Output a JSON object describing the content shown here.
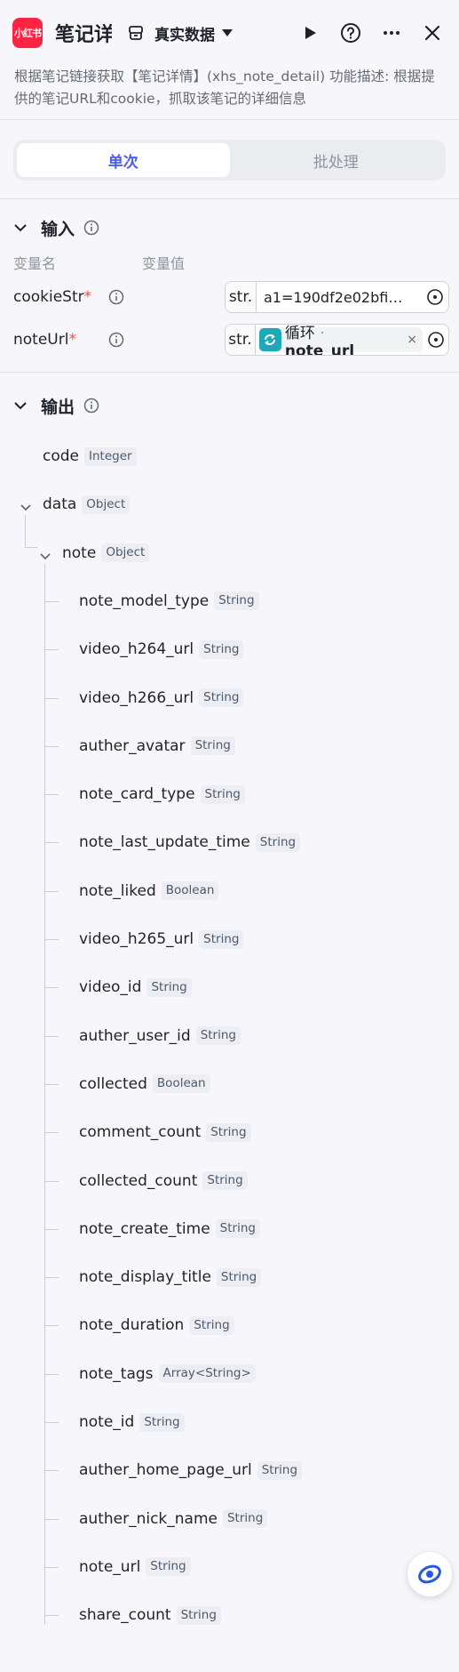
{
  "header": {
    "logo_text": "小红书",
    "title": "笔记详情",
    "dataset_label": "真实数据",
    "icons": [
      "dataset-icon",
      "caret-down-icon",
      "play-icon",
      "help-icon",
      "more-icon",
      "close-icon"
    ]
  },
  "description": "根据笔记链接获取【笔记详情】(xhs_note_detail) 功能描述: 根据提供的笔记URL和cookie，抓取该笔记的详细信息",
  "tabs": [
    {
      "label": "单次",
      "active": true
    },
    {
      "label": "批处理",
      "active": false
    }
  ],
  "input_section": {
    "title": "输入",
    "col_name": "变量名",
    "col_value": "变量值",
    "vars": [
      {
        "name": "cookieStr",
        "required": "*",
        "type": "str.",
        "value": "a1=190df2e02bfi…"
      },
      {
        "name": "noteUrl",
        "required": "*",
        "type": "str.",
        "ref_source": "循环",
        "ref_sep": " · ",
        "ref_var": "note_url",
        "remove": "×"
      }
    ]
  },
  "output_section": {
    "title": "输出",
    "fields": [
      {
        "name": "code",
        "type": "Integer"
      },
      {
        "name": "data",
        "type": "Object"
      },
      {
        "name": "note",
        "type": "Object"
      },
      {
        "name": "note_model_type",
        "type": "String"
      },
      {
        "name": "video_h264_url",
        "type": "String"
      },
      {
        "name": "video_h266_url",
        "type": "String"
      },
      {
        "name": "auther_avatar",
        "type": "String"
      },
      {
        "name": "note_card_type",
        "type": "String"
      },
      {
        "name": "note_last_update_time",
        "type": "String"
      },
      {
        "name": "note_liked",
        "type": "Boolean"
      },
      {
        "name": "video_h265_url",
        "type": "String"
      },
      {
        "name": "video_id",
        "type": "String"
      },
      {
        "name": "auther_user_id",
        "type": "String"
      },
      {
        "name": "collected",
        "type": "Boolean"
      },
      {
        "name": "comment_count",
        "type": "String"
      },
      {
        "name": "collected_count",
        "type": "String"
      },
      {
        "name": "note_create_time",
        "type": "String"
      },
      {
        "name": "note_display_title",
        "type": "String"
      },
      {
        "name": "note_duration",
        "type": "String"
      },
      {
        "name": "note_tags",
        "type": "Array<String>"
      },
      {
        "name": "note_id",
        "type": "String"
      },
      {
        "name": "auther_home_page_url",
        "type": "String"
      },
      {
        "name": "auther_nick_name",
        "type": "String"
      },
      {
        "name": "note_url",
        "type": "String"
      },
      {
        "name": "share_count",
        "type": "String"
      }
    ]
  },
  "colors": {
    "accent": "#4b5cf0",
    "brand": "#ff2442",
    "required": "#f54a45",
    "loop": "#1ea8b8"
  }
}
